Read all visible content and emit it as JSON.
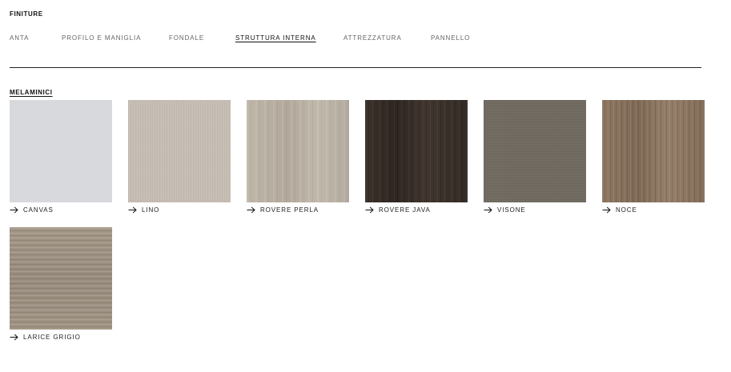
{
  "section": {
    "title": "FINITURE"
  },
  "tabs": [
    {
      "label": "ANTA"
    },
    {
      "label": "PROFILO E MANIGLIA"
    },
    {
      "label": "FONDALE"
    },
    {
      "label": "STRUTTURA INTERNA",
      "active": true
    },
    {
      "label": "ATTREZZATURA"
    },
    {
      "label": "PANNELLO"
    }
  ],
  "group": {
    "title": "MELAMINICI"
  },
  "swatches": [
    {
      "label": "CANVAS",
      "color": "#d7d9dc"
    },
    {
      "label": "LINO",
      "color": "#c6bdb3"
    },
    {
      "label": "ROVERE PERLA",
      "color": "#b9b0a3"
    },
    {
      "label": "ROVERE JAVA",
      "color": "#3a302b"
    },
    {
      "label": "VISONE",
      "color": "#716a61"
    },
    {
      "label": "NOCE",
      "color": "#8b7560"
    },
    {
      "label": "LARICE GRIGIO",
      "color": "#9d9182"
    }
  ],
  "icons": {
    "caption_arrow": "arrow-right-icon"
  }
}
